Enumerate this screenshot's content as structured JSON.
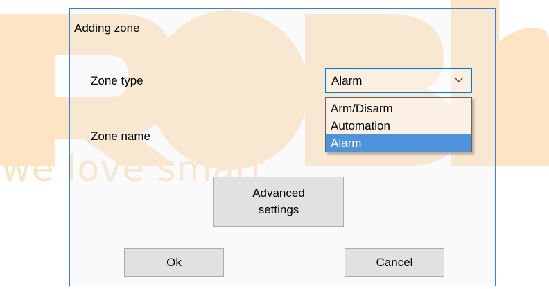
{
  "watermark": {
    "tagline": "we love smart",
    "color": "#fbe2c4"
  },
  "dialog": {
    "title": "Adding zone",
    "zone_type_label": "Zone type",
    "zone_name_label": "Zone name",
    "zone_type": {
      "selected": "Alarm",
      "options": [
        "Arm/Disarm",
        "Automation",
        "Alarm"
      ],
      "highlighted_index": 2
    },
    "advanced_button_label": "Advanced settings",
    "ok_label": "Ok",
    "cancel_label": "Cancel"
  },
  "colors": {
    "accent": "#0078d7",
    "highlight": "#4f93da",
    "button_face": "#e1e1e1"
  }
}
